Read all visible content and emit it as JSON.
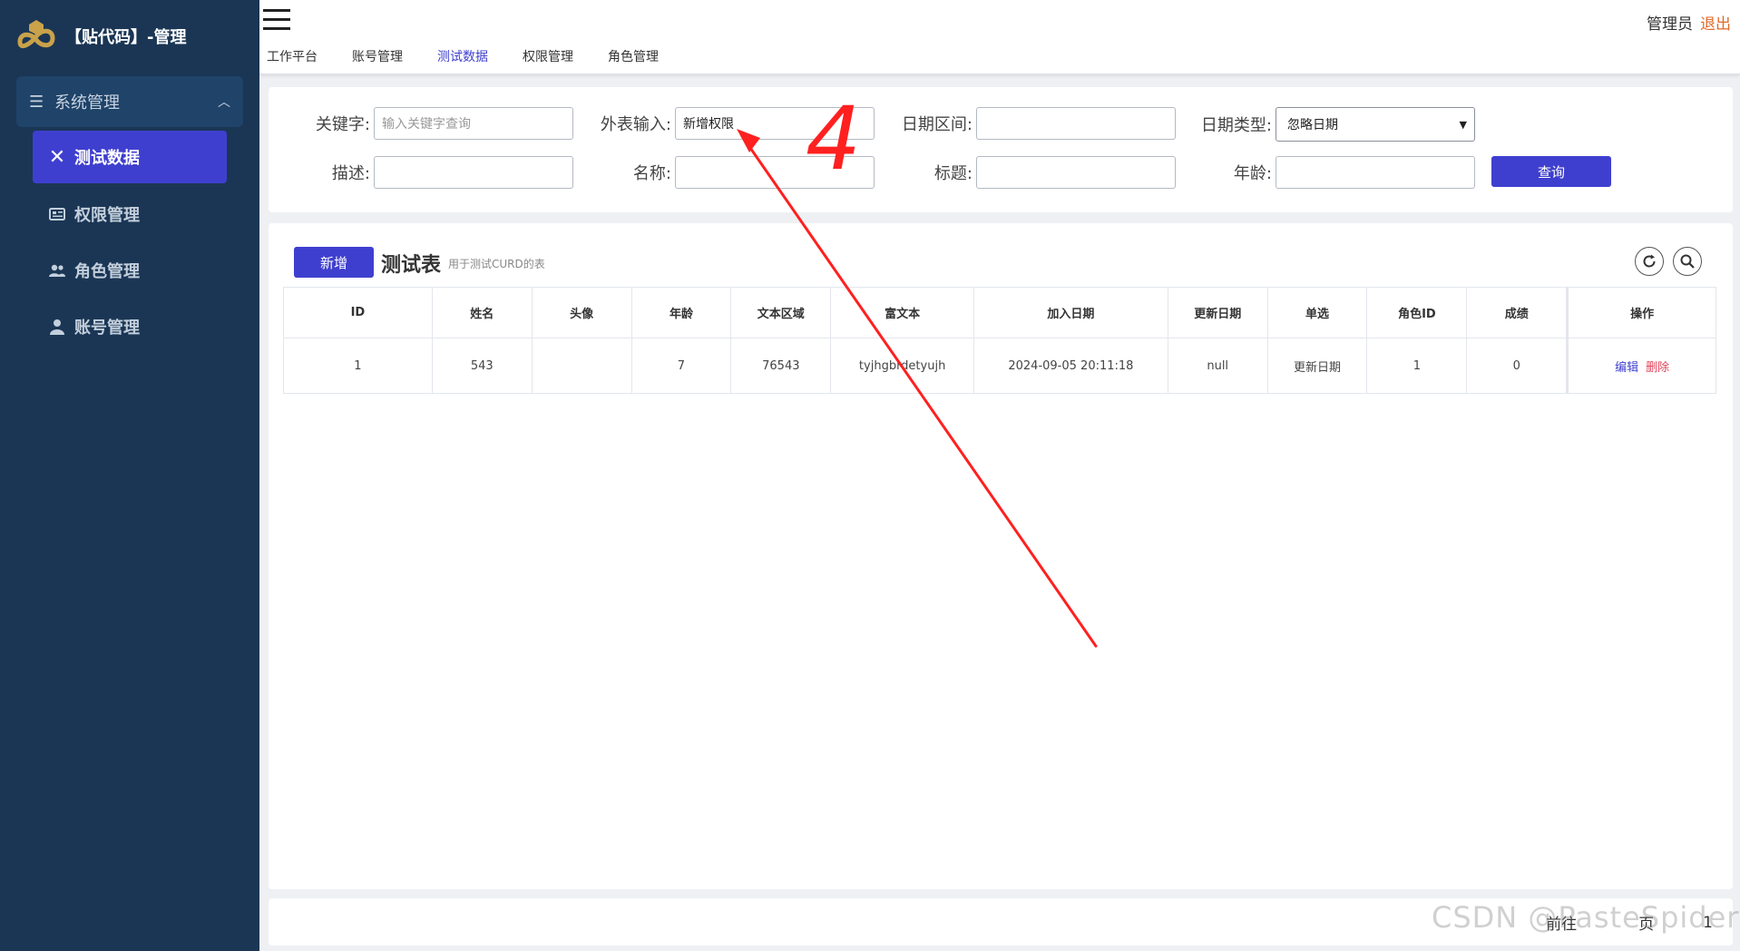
{
  "app": {
    "title": "【贴代码】-管理",
    "user_label": "管理员",
    "logout_label": "退出"
  },
  "sidebar": {
    "group_label": "系统管理",
    "items": [
      {
        "label": "测试数据",
        "icon": "close-icon",
        "active": true
      },
      {
        "label": "权限管理",
        "icon": "id-card-icon",
        "active": false
      },
      {
        "label": "角色管理",
        "icon": "users-icon",
        "active": false
      },
      {
        "label": "账号管理",
        "icon": "user-icon",
        "active": false
      }
    ]
  },
  "nav": {
    "tabs": [
      {
        "label": "工作平台",
        "active": false
      },
      {
        "label": "账号管理",
        "active": false
      },
      {
        "label": "测试数据",
        "active": true
      },
      {
        "label": "权限管理",
        "active": false
      },
      {
        "label": "角色管理",
        "active": false
      }
    ]
  },
  "search": {
    "keyword": {
      "label": "关键字:",
      "value": "",
      "placeholder": "输入关键字查询"
    },
    "foreign": {
      "label": "外表输入:",
      "value": "新增权限"
    },
    "date_range": {
      "label": "日期区间:",
      "value": ""
    },
    "date_type": {
      "label": "日期类型:",
      "selected": "忽略日期"
    },
    "desc": {
      "label": "描述:",
      "value": ""
    },
    "name": {
      "label": "名称:",
      "value": ""
    },
    "title": {
      "label": "标题:",
      "value": ""
    },
    "age": {
      "label": "年龄:",
      "value": ""
    },
    "query_label": "查询"
  },
  "table": {
    "add_label": "新增",
    "title": "测试表",
    "subtitle": "用于测试CURD的表",
    "columns": [
      "ID",
      "姓名",
      "头像",
      "年龄",
      "文本区域",
      "富文本",
      "加入日期",
      "更新日期",
      "单选",
      "角色ID",
      "成绩",
      "操作"
    ],
    "rows": [
      {
        "cells": [
          "1",
          "543",
          "",
          "7",
          "76543",
          "tyjhgbrdetyujh",
          "2024-09-05 20:11:18",
          "null",
          "更新日期",
          "1",
          "0"
        ],
        "edit": "编辑",
        "delete": "删除"
      }
    ]
  },
  "pager": {
    "goto_label": "前往",
    "page_suffix": "页",
    "page_value": "1"
  },
  "annotation": {
    "label": "4",
    "color": "#ff2020"
  },
  "watermark": "CSDN @PasteSpider",
  "colors": {
    "sidebar_bg": "#1b3655",
    "accent": "#3f3fcf",
    "danger": "#e0445a",
    "logout": "#e06a2a"
  }
}
